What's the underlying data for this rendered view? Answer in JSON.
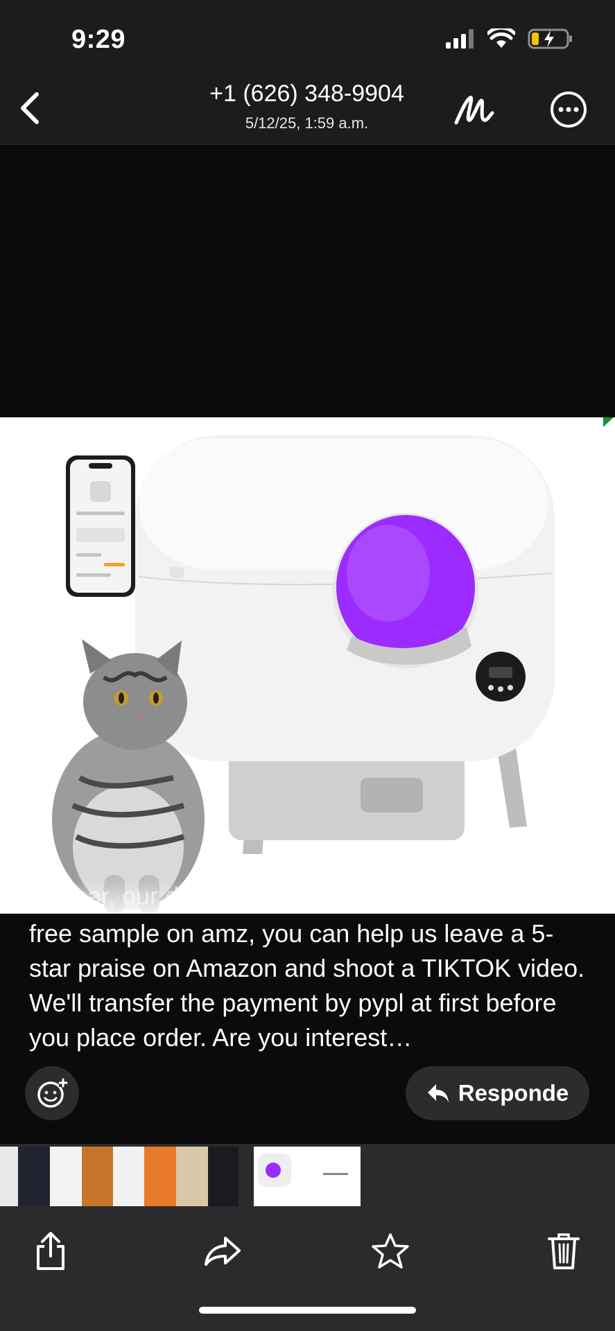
{
  "status_bar": {
    "time": "9:29",
    "icons": [
      "cellular-signal-icon",
      "wifi-icon",
      "battery-charging-icon"
    ]
  },
  "header": {
    "back_icon": "chevron-left-icon",
    "title": "+1 (626) 348-9904",
    "subtitle": "5/12/25, 1:59 a.m.",
    "markup_icon": "markup-icon",
    "more_icon": "ellipsis-circle-icon"
  },
  "photo": {
    "description_icons": [
      "phone-app-icon",
      "cat-image",
      "litter-box-image",
      "purple-uv-light-icon",
      "control-panel-icon"
    ]
  },
  "message": {
    "ghost_line": "Hi dear, our demand is that after you get the",
    "text": "free sample on amz, you can help us leave a 5-star praise on Amazon and shoot a TIKTOK video.  We'll transfer the payment by pypl at first before you place order. Are you interest…"
  },
  "actions": {
    "emoji_icon": "add-reaction-icon",
    "reply_label": "Responde",
    "reply_icon": "reply-arrow-icon"
  },
  "toolbar": {
    "share_icon": "share-icon",
    "forward_icon": "forward-icon",
    "favorite_icon": "star-icon",
    "delete_icon": "trash-icon"
  },
  "colors": {
    "bar_bg": "#1c1c1e",
    "toolbar_bg": "#2b2b2d",
    "purple": "#9b2bff",
    "battery_yellow": "#f5c400"
  }
}
